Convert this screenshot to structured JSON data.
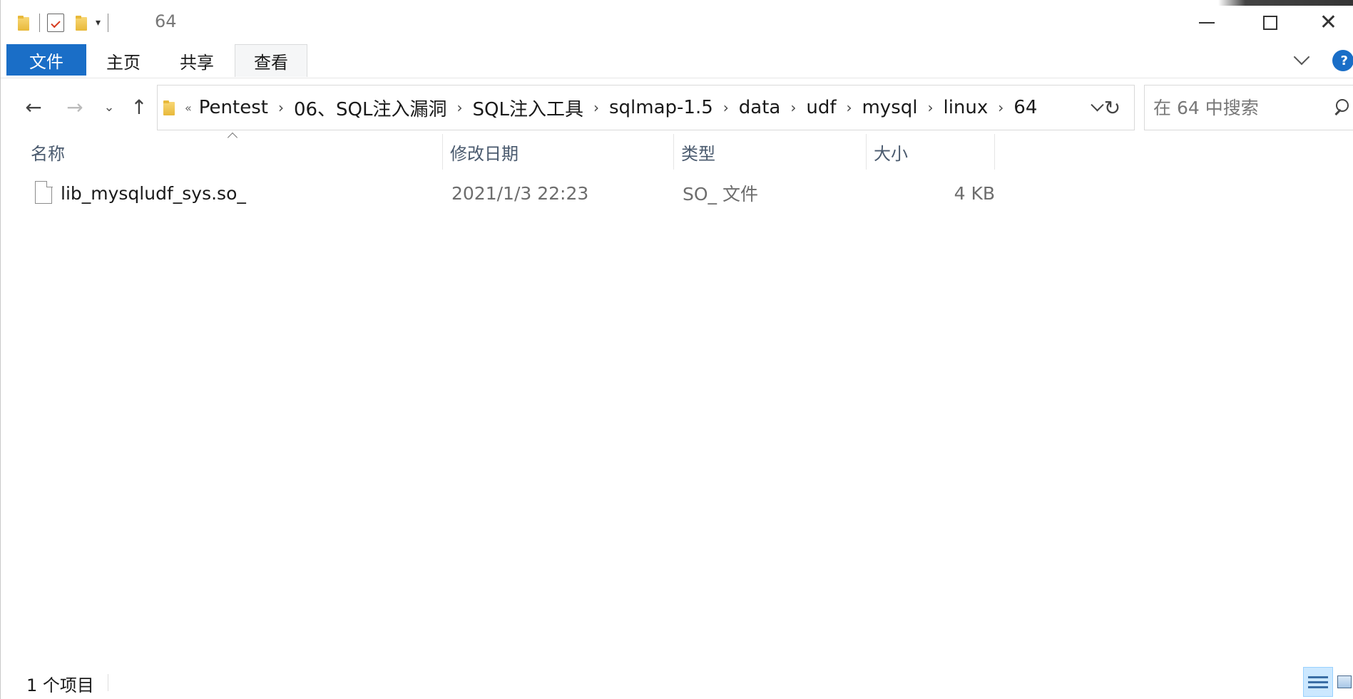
{
  "window": {
    "title": "64"
  },
  "ribbon": {
    "tabs": [
      "文件",
      "主页",
      "共享",
      "查看"
    ]
  },
  "nav": {
    "overflow_label": "«",
    "breadcrumbs": [
      "Pentest",
      "06、SQL注入漏洞",
      "SQL注入工具",
      "sqlmap-1.5",
      "data",
      "udf",
      "mysql",
      "linux",
      "64"
    ],
    "refresh_glyph": "↻"
  },
  "search": {
    "placeholder": "在 64 中搜索"
  },
  "columns": {
    "name": "名称",
    "date": "修改日期",
    "type": "类型",
    "size": "大小"
  },
  "files": [
    {
      "name": "lib_mysqludf_sys.so_",
      "date": "2021/1/3 22:23",
      "type": "SO_ 文件",
      "size": "4 KB"
    }
  ],
  "status": {
    "item_count": "1 个项目"
  },
  "colors": {
    "accent": "#1a6ec7",
    "header_text": "#4a5a6e",
    "selected_view": "#cce8ff"
  },
  "icons": {
    "back": "arrow-left-icon",
    "forward": "arrow-right-icon",
    "recent": "chevron-down-icon",
    "up": "arrow-up-icon",
    "search": "search-icon",
    "help": "help-icon"
  }
}
